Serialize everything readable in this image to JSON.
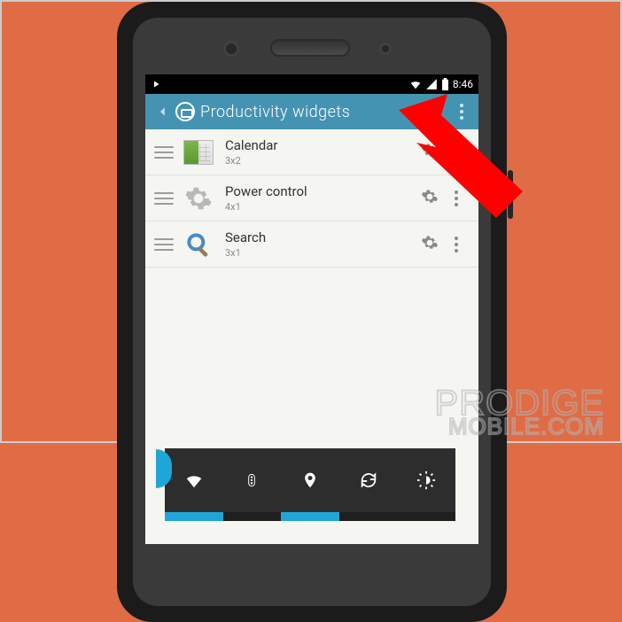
{
  "statusbar": {
    "time": "8:46"
  },
  "appbar": {
    "title": "Productivity widgets"
  },
  "items": [
    {
      "name": "Calendar",
      "size": "3x2"
    },
    {
      "name": "Power control",
      "size": "4x1"
    },
    {
      "name": "Search",
      "size": "3x1"
    }
  ],
  "watermark": {
    "line1": "PRODIGE",
    "line2": "MOBILE.COM"
  }
}
